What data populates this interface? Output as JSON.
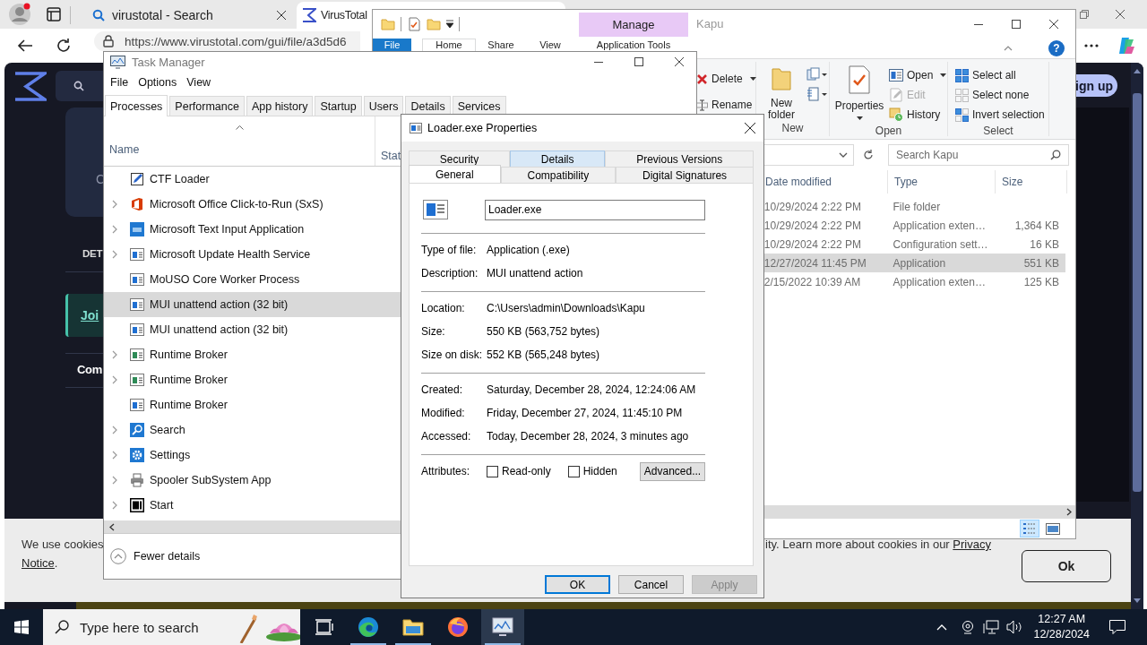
{
  "browser": {
    "tabs": [
      {
        "label": "virustotal - Search",
        "kind": "search",
        "selected": false
      },
      {
        "label": "VirusTotal",
        "kind": "site",
        "selected": true
      }
    ],
    "url": "https://www.virustotal.com/gui/file/a3d5d6",
    "page": {
      "card_text": "C",
      "section_heading": "DET",
      "join_link": "Joi",
      "community_heading": "Com",
      "sign_up": "ign up"
    },
    "cookie": {
      "left_text": "We use cookies",
      "left_link": "Notice",
      "left_end": ".",
      "right_text": "ity. Learn more about cookies in our ",
      "right_link": "Privacy",
      "ok": "Ok"
    }
  },
  "explorer": {
    "title": "Kapu",
    "context_header": "Manage",
    "ribbon_tabs": [
      {
        "label": "File",
        "kind": "file",
        "selected": false
      },
      {
        "label": "Home",
        "kind": "tab",
        "selected": true
      },
      {
        "label": "Share",
        "kind": "tab",
        "selected": false
      },
      {
        "label": "View",
        "kind": "tab",
        "selected": false
      },
      {
        "label": "Application Tools",
        "kind": "tab",
        "selected": false
      }
    ],
    "help": "?",
    "organize": [
      {
        "label": "Delete",
        "kind": "delete",
        "dropdown": true
      },
      {
        "label": "Rename",
        "kind": "rename",
        "dropdown": false
      }
    ],
    "new_group": {
      "label": "New",
      "new_folder": "New folder"
    },
    "open_group": {
      "label": "Open",
      "properties": "Properties",
      "items": [
        {
          "label": "Open",
          "kind": "open",
          "dropdown": true,
          "disabled": false
        },
        {
          "label": "Edit",
          "kind": "edit",
          "dropdown": false,
          "disabled": true
        },
        {
          "label": "History",
          "kind": "history",
          "dropdown": false,
          "disabled": false
        }
      ]
    },
    "select_group": {
      "label": "Select",
      "items": [
        {
          "label": "Select all",
          "kind": "all"
        },
        {
          "label": "Select none",
          "kind": "none"
        },
        {
          "label": "Invert selection",
          "kind": "invert"
        }
      ]
    },
    "search_placeholder": "Search Kapu",
    "columns": [
      "Date modified",
      "Type",
      "Size"
    ],
    "rows": [
      {
        "date": "10/29/2024 2:22 PM",
        "type": "File folder",
        "selected": false
      },
      {
        "date": "10/29/2024 2:22 PM",
        "type": "Application exten…",
        "size": "1,364 KB",
        "selected": false
      },
      {
        "date": "10/29/2024 2:22 PM",
        "type": "Configuration sett…",
        "size": "16 KB",
        "selected": false
      },
      {
        "date": "12/27/2024 11:45 PM",
        "type": "Application",
        "size": "551 KB",
        "selected": true
      },
      {
        "date": "2/15/2022 10:39 AM",
        "type": "Application exten…",
        "size": "125 KB",
        "selected": false
      }
    ],
    "view_modes": [
      {
        "kind": "details",
        "selected": true
      },
      {
        "kind": "tiles",
        "selected": false
      }
    ]
  },
  "task_manager": {
    "title": "Task Manager",
    "menu": [
      "File",
      "Options",
      "View"
    ],
    "tabs": [
      {
        "label": "Processes",
        "selected": true
      },
      {
        "label": "Performance",
        "selected": false
      },
      {
        "label": "App history",
        "selected": false
      },
      {
        "label": "Startup",
        "selected": false
      },
      {
        "label": "Users",
        "selected": false
      },
      {
        "label": "Details",
        "selected": false
      },
      {
        "label": "Services",
        "selected": false
      }
    ],
    "columns": [
      "Name",
      "Stat"
    ],
    "processes": [
      {
        "name": "CTF Loader",
        "kind": "pen",
        "expandable": false,
        "selected": false
      },
      {
        "name": "Microsoft Office Click-to-Run (SxS)",
        "kind": "office",
        "expandable": true,
        "selected": false
      },
      {
        "name": "Microsoft Text Input Application",
        "kind": "keyboard",
        "expandable": true,
        "selected": false
      },
      {
        "name": "Microsoft Update Health Service",
        "kind": "service",
        "expandable": true,
        "selected": false
      },
      {
        "name": "MoUSO Core Worker Process",
        "kind": "service",
        "expandable": false,
        "selected": false
      },
      {
        "name": "MUI unattend action (32 bit)",
        "kind": "service",
        "expandable": false,
        "selected": true
      },
      {
        "name": "MUI unattend action (32 bit)",
        "kind": "service",
        "expandable": false,
        "selected": false
      },
      {
        "name": "Runtime Broker",
        "kind": "broker",
        "expandable": true,
        "selected": false
      },
      {
        "name": "Runtime Broker",
        "kind": "broker",
        "expandable": true,
        "selected": false
      },
      {
        "name": "Runtime Broker",
        "kind": "service",
        "expandable": false,
        "selected": false
      },
      {
        "name": "Search",
        "kind": "search",
        "expandable": true,
        "selected": false
      },
      {
        "name": "Settings",
        "kind": "settings",
        "expandable": true,
        "selected": false
      },
      {
        "name": "Spooler SubSystem App",
        "kind": "printer",
        "expandable": true,
        "selected": false
      },
      {
        "name": "Start",
        "kind": "start",
        "expandable": true,
        "selected": false
      }
    ],
    "footer": "Fewer details"
  },
  "properties": {
    "title": "Loader.exe Properties",
    "tab_rows": [
      [
        {
          "label": "Security",
          "selected": false,
          "highlighted": false
        },
        {
          "label": "Details",
          "selected": false,
          "highlighted": true
        },
        {
          "label": "Previous Versions",
          "selected": false,
          "highlighted": false
        }
      ],
      [
        {
          "label": "General",
          "selected": true,
          "highlighted": false
        },
        {
          "label": "Compatibility",
          "selected": false,
          "highlighted": false
        },
        {
          "label": "Digital Signatures",
          "selected": false,
          "highlighted": false
        }
      ]
    ],
    "file_name": "Loader.exe",
    "sections": [
      [
        {
          "label": "Type of file:",
          "value": "Application (.exe)"
        },
        {
          "label": "Description:",
          "value": "MUI unattend action"
        }
      ],
      [
        {
          "label": "Location:",
          "value": "C:\\Users\\admin\\Downloads\\Kapu"
        },
        {
          "label": "Size:",
          "value": "550 KB (563,752 bytes)"
        },
        {
          "label": "Size on disk:",
          "value": "552 KB (565,248 bytes)"
        }
      ],
      [
        {
          "label": "Created:",
          "value": "Saturday, December 28, 2024, 12:24:06 AM"
        },
        {
          "label": "Modified:",
          "value": "Friday, December 27, 2024, 11:45:10 PM"
        },
        {
          "label": "Accessed:",
          "value": "Today, December 28, 2024, 3 minutes ago"
        }
      ]
    ],
    "attributes_label": "Attributes:",
    "attributes": [
      {
        "label": "Read-only",
        "checked": false
      },
      {
        "label": "Hidden",
        "checked": false
      }
    ],
    "advanced": "Advanced...",
    "buttons": [
      {
        "label": "OK",
        "default": true,
        "disabled": false
      },
      {
        "label": "Cancel",
        "default": false,
        "disabled": false
      },
      {
        "label": "Apply",
        "default": false,
        "disabled": true
      }
    ]
  },
  "taskbar": {
    "search_placeholder": "Type here to search",
    "apps": [
      {
        "kind": "taskview",
        "running": false,
        "selected": false
      },
      {
        "kind": "edge",
        "running": true,
        "selected": false
      },
      {
        "kind": "files",
        "running": true,
        "selected": false
      },
      {
        "kind": "firefox",
        "running": false,
        "selected": false
      },
      {
        "kind": "taskmgr",
        "running": true,
        "selected": true
      }
    ],
    "time": "12:27 AM",
    "date": "12/28/2024"
  }
}
